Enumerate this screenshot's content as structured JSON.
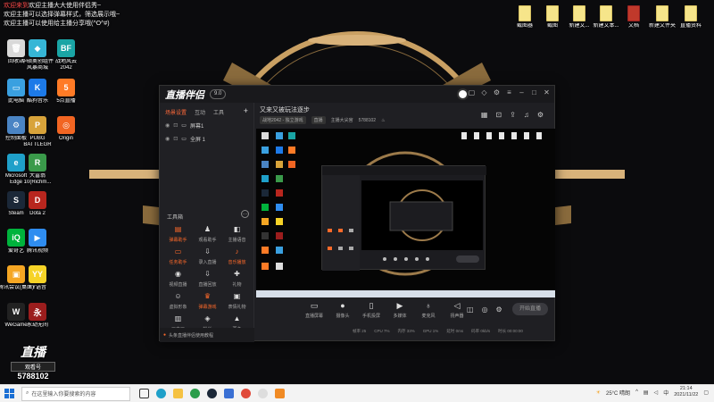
{
  "overlay": {
    "lines": [
      {
        "prefix": "欢迎来到",
        "text": "欢迎主播大大使用伴侣秀~"
      },
      {
        "prefix": "",
        "text": "欢迎主播可以选择弹幕样式，筛选展示哦~"
      },
      {
        "prefix": "",
        "text": "欢迎主播可以使用给主播分享哦(^O^#)"
      }
    ]
  },
  "desktop_left": [
    {
      "label": "回收站",
      "name": "recycle-bin",
      "color": "#d9d9d9",
      "glyph": "🗑"
    },
    {
      "label": "华硕奥创组件\n风暴商城",
      "name": "asus-armoury",
      "color": "#36b6d6",
      "glyph": "◆"
    },
    {
      "label": "战地风云\n2042",
      "name": "battlefield-2042",
      "color": "#1aa5a5",
      "glyph": "BF"
    },
    {
      "label": "此电脑",
      "name": "this-pc",
      "color": "#3aa0e0",
      "glyph": "▭"
    },
    {
      "label": "酷狗音乐",
      "name": "kugou",
      "color": "#1d7ae8",
      "glyph": "K"
    },
    {
      "label": "5点直播",
      "name": "fivepoint-live",
      "color": "#ff7b26",
      "glyph": "5"
    },
    {
      "label": "控制面板",
      "name": "control-panel",
      "color": "#4a84c4",
      "glyph": "⚙"
    },
    {
      "label": "PUBG\nBATTLEGR",
      "name": "pubg",
      "color": "#d8a33a",
      "glyph": "P"
    },
    {
      "label": "Origin",
      "name": "origin",
      "color": "#f26522",
      "glyph": "◎"
    },
    {
      "label": "Microsoft\nEdge",
      "name": "edge",
      "color": "#1fa0c9",
      "glyph": "e"
    },
    {
      "label": "大富翁\n10(Richm...",
      "name": "richman-10",
      "color": "#3a9a4a",
      "glyph": "R"
    },
    {
      "label": "Steam",
      "name": "steam",
      "color": "#1b2838",
      "glyph": "S"
    },
    {
      "label": "Dota 2",
      "name": "dota2",
      "color": "#b8261e",
      "glyph": "D"
    },
    {
      "label": "爱奇艺",
      "name": "iqiyi",
      "color": "#00b33c",
      "glyph": "iQ"
    },
    {
      "label": "腾讯视频",
      "name": "tencent-video",
      "color": "#2f8df0",
      "glyph": "▶"
    },
    {
      "label": "腾讯会议(桌面)",
      "name": "tencent-meeting",
      "color": "#f5a623",
      "glyph": "▣"
    },
    {
      "label": "YY语音",
      "name": "yy",
      "color": "#f6d327",
      "glyph": "YY"
    },
    {
      "label": "WeGame",
      "name": "wegame",
      "color": "#222222",
      "glyph": "W"
    },
    {
      "label": "永劫无间",
      "name": "naraka",
      "color": "#9b1d1d",
      "glyph": "永"
    }
  ],
  "desktop_right": [
    {
      "label": "截图器"
    },
    {
      "label": "截图"
    },
    {
      "label": "新建文..."
    },
    {
      "label": "新建文本..."
    },
    {
      "label": "文档"
    },
    {
      "label": "新建文件夹"
    },
    {
      "label": "直播资料"
    }
  ],
  "app": {
    "logo": "直播伴侣",
    "version_pill": "9.0",
    "scene_tabs": [
      "场景设置",
      "互动",
      "工具"
    ],
    "sources": [
      {
        "name": "屏幕1"
      },
      {
        "name": "全屏 1"
      }
    ],
    "tools_title": "工具箱",
    "tools": [
      {
        "label": "弹幕助手",
        "icon": "▤",
        "orange": true
      },
      {
        "label": "观看助手",
        "icon": "♟",
        "orange": false
      },
      {
        "label": "主播语音",
        "icon": "◧",
        "orange": false
      },
      {
        "label": "任务助手",
        "icon": "▭",
        "orange": true
      },
      {
        "label": "录入直播",
        "icon": "⇩",
        "orange": false
      },
      {
        "label": "音乐播放",
        "icon": "♪",
        "orange": true
      },
      {
        "label": "视频直播",
        "icon": "◉",
        "orange": false
      },
      {
        "label": "直播回放",
        "icon": "⇩",
        "orange": false
      },
      {
        "label": "礼物",
        "icon": "✚",
        "orange": false
      },
      {
        "label": "虚拟形象",
        "icon": "☺",
        "orange": false
      },
      {
        "label": "弹幕游戏",
        "icon": "♛",
        "orange": true
      },
      {
        "label": "表情礼物",
        "icon": "▣",
        "orange": false
      },
      {
        "label": "画中画",
        "icon": "▥",
        "orange": false
      },
      {
        "label": "粉丝",
        "icon": "◈",
        "orange": false
      },
      {
        "label": "更多",
        "icon": "▲",
        "orange": false
      }
    ],
    "tip": "头条直播伴侣使用教程",
    "room_title": "又来又被玩法逐步",
    "room_meta": {
      "chip1": "战地2042 - 独立游戏",
      "chip2": "直播",
      "host": "主播大尖宫",
      "id": "5788102"
    },
    "bottom_controls": [
      {
        "label": "直播屏幕",
        "icon": "▭"
      },
      {
        "label": "摄像头",
        "icon": "●"
      },
      {
        "label": "手机投屏",
        "icon": "▯"
      },
      {
        "label": "多媒体",
        "icon": "▶"
      },
      {
        "label": "麦克风",
        "icon": "♁"
      },
      {
        "label": "扬声器",
        "icon": "◁"
      }
    ],
    "start_live": "开始直播",
    "stats": [
      "帧率 25",
      "CPU 7%",
      "内存 33%",
      "GPU 1%",
      "延时 0ms",
      "码率 0kb/s",
      "时长 00:00:00"
    ]
  },
  "watermark": {
    "title": "直播",
    "sub": "观看号",
    "id": "5788102"
  },
  "taskbar": {
    "search_placeholder": "在这里输入你要搜索的内容",
    "weather": "25°C 晴朗",
    "time": "21:14",
    "date": "2021/11/22",
    "lang": "中"
  }
}
